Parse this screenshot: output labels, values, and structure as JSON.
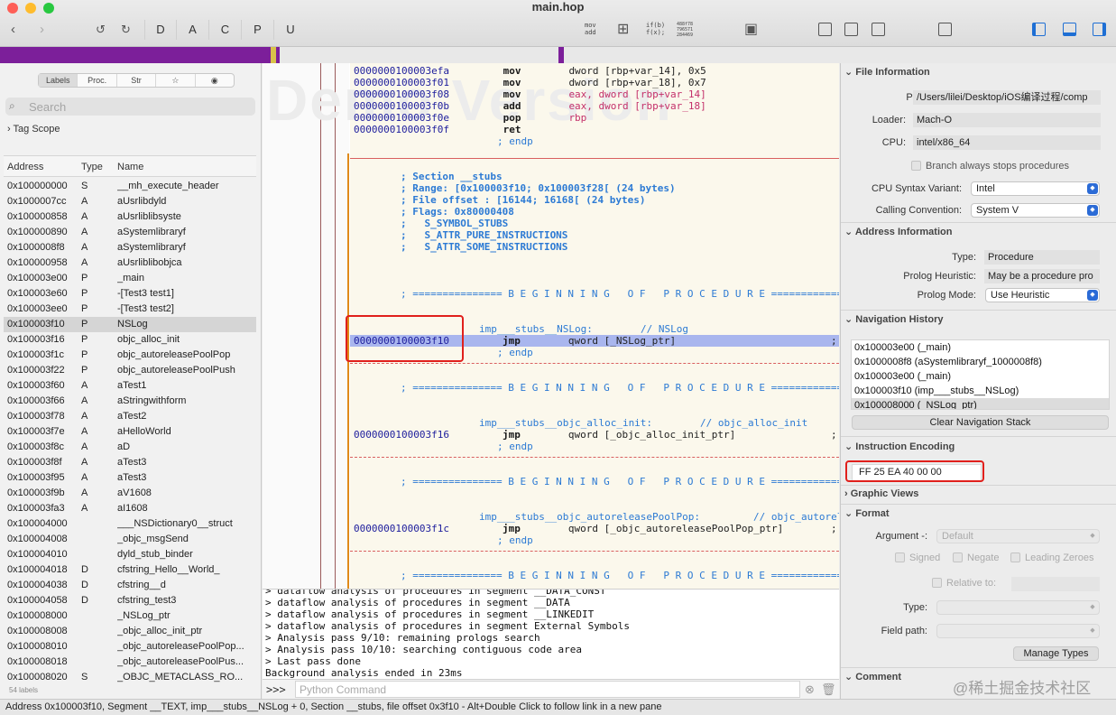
{
  "window": {
    "title": "main.hop"
  },
  "colors": {
    "accent": "#1f6fd4",
    "nav_band": "#7c1f9a",
    "highlight": "#a9b6ee",
    "callout": "#e0201c"
  },
  "toolbar": {
    "back_icon": "chevron-left-icon",
    "forward_icon": "chevron-right-icon",
    "undo_icon": "undo-icon",
    "redo_icon": "redo-icon",
    "mode_letters": [
      "D",
      "A",
      "C",
      "P",
      "U"
    ],
    "mov_add_line1": "mov",
    "mov_add_line2": "add",
    "ifb_line1": "if(b)",
    "ifb_line2": "f(x);",
    "hex_line1": "488f78",
    "hex_line2": "796571",
    "hex_line3": "284469"
  },
  "sidebar": {
    "tabs": [
      "Labels",
      "Proc.",
      "Str",
      "☆",
      "◉"
    ],
    "search_placeholder": "Search",
    "tag_scope": "Tag Scope",
    "columns": {
      "address": "Address",
      "type": "Type",
      "name": "Name"
    },
    "rows": [
      [
        "0x100000000",
        "S",
        "__mh_execute_header"
      ],
      [
        "0x1000007cc",
        "A",
        "aUsrlibdyld"
      ],
      [
        "0x100000858",
        "A",
        "aUsrliblibsyste"
      ],
      [
        "0x100000890",
        "A",
        "aSystemlibraryf"
      ],
      [
        "0x1000008f8",
        "A",
        "aSystemlibraryf"
      ],
      [
        "0x100000958",
        "A",
        "aUsrliblibobjca"
      ],
      [
        "0x100003e00",
        "P",
        "_main"
      ],
      [
        "0x100003e60",
        "P",
        "-[Test3 test1]"
      ],
      [
        "0x100003ee0",
        "P",
        "-[Test3 test2]"
      ],
      [
        "0x100003f10",
        "P",
        "NSLog"
      ],
      [
        "0x100003f16",
        "P",
        "objc_alloc_init"
      ],
      [
        "0x100003f1c",
        "P",
        "objc_autoreleasePoolPop"
      ],
      [
        "0x100003f22",
        "P",
        "objc_autoreleasePoolPush"
      ],
      [
        "0x100003f60",
        "A",
        "aTest1"
      ],
      [
        "0x100003f66",
        "A",
        "aStringwithform"
      ],
      [
        "0x100003f78",
        "A",
        "aTest2"
      ],
      [
        "0x100003f7e",
        "A",
        "aHelloWorld"
      ],
      [
        "0x100003f8c",
        "A",
        "aD"
      ],
      [
        "0x100003f8f",
        "A",
        "aTest3"
      ],
      [
        "0x100003f95",
        "A",
        "aTest3"
      ],
      [
        "0x100003f9b",
        "A",
        "aV1608"
      ],
      [
        "0x100003fa3",
        "A",
        "aI1608"
      ],
      [
        "0x100004000",
        "",
        "___NSDictionary0__struct"
      ],
      [
        "0x100004008",
        "",
        "_objc_msgSend"
      ],
      [
        "0x100004010",
        "",
        "dyld_stub_binder"
      ],
      [
        "0x100004018",
        "D",
        "cfstring_Hello__World_"
      ],
      [
        "0x100004038",
        "D",
        "cfstring__d"
      ],
      [
        "0x100004058",
        "D",
        "cfstring_test3"
      ],
      [
        "0x100008000",
        "",
        "_NSLog_ptr"
      ],
      [
        "0x100008008",
        "",
        "_objc_alloc_init_ptr"
      ],
      [
        "0x100008010",
        "",
        "_objc_autoreleasePoolPop..."
      ],
      [
        "0x100008018",
        "",
        "_objc_autoreleasePoolPus..."
      ],
      [
        "0x100008020",
        "S",
        "_OBJC_METACLASS_RO..."
      ]
    ],
    "selected_row": 9,
    "label_count": "54 labels"
  },
  "code": {
    "watermark": "Demo Version",
    "prologue": [
      [
        "0000000100003efa",
        "mov",
        "dword [rbp+var_14], 0x5"
      ],
      [
        "0000000100003f01",
        "mov",
        "dword [rbp+var_18], 0x7"
      ],
      [
        "0000000100003f08",
        "mov",
        "eax, dword [rbp+var_14]"
      ],
      [
        "0000000100003f0b",
        "add",
        "eax, dword [rbp+var_18]"
      ],
      [
        "0000000100003f0e",
        "pop",
        "rbp"
      ],
      [
        "0000000100003f0f",
        "ret",
        ""
      ]
    ],
    "endp": "; endp",
    "section_header": [
      "; Section __stubs",
      "; Range: [0x100003f10; 0x100003f28[ (24 bytes)",
      "; File offset : [16144; 16168[ (24 bytes)",
      "; Flags: 0x80000408",
      ";   S_SYMBOL_STUBS",
      ";   S_ATTR_PURE_INSTRUCTIONS",
      ";   S_ATTR_SOME_INSTRUCTIONS"
    ],
    "begin_proc": "; =============== B E G I N N I N G   O F   P R O C E D U R E ================",
    "procs": [
      {
        "label": "imp___stubs__NSLog:",
        "comment": "// NSLog",
        "addr": "0000000100003f10",
        "mnem": "jmp",
        "operand": "qword [_NSLog_ptr]",
        "tail": ";"
      },
      {
        "label": "imp___stubs__objc_alloc_init:",
        "comment": "// objc_alloc_init",
        "addr": "0000000100003f16",
        "mnem": "jmp",
        "operand": "qword [_objc_alloc_init_ptr]",
        "tail": ";"
      },
      {
        "label": "imp___stubs__objc_autoreleasePoolPop:",
        "comment": "// objc_autorele",
        "addr": "0000000100003f1c",
        "mnem": "jmp",
        "operand": "qword [_objc_autoreleasePoolPop_ptr]",
        "tail": ";"
      }
    ]
  },
  "console": {
    "lines": [
      "> dataflow analysis of procedures in segment __DATA_CONST",
      "> dataflow analysis of procedures in segment __DATA",
      "> dataflow analysis of procedures in segment __LINKEDIT",
      "> dataflow analysis of procedures in segment External Symbols",
      "> Analysis pass 9/10: remaining prologs search",
      "> Analysis pass 10/10: searching contiguous code area",
      "> Last pass done",
      "Background analysis ended in 23ms"
    ],
    "prompt": ">>>",
    "input_placeholder": "Python Command"
  },
  "status_bar": "Address 0x100003f10, Segment __TEXT, imp___stubs__NSLog + 0, Section __stubs, file offset 0x3f10 - Alt+Double Click to follow link in a new pane",
  "inspector": {
    "file_info": {
      "title": "File Information",
      "path_label": "Path:",
      "path": "/Users/lilei/Desktop/iOS编译过程/comp",
      "loader_label": "Loader:",
      "loader": "Mach-O",
      "cpu_label": "CPU:",
      "cpu": "intel/x86_64",
      "branch_label": "Branch always stops procedures",
      "syntax_label": "CPU Syntax Variant:",
      "syntax": "Intel",
      "calling_label": "Calling Convention:",
      "calling": "System V"
    },
    "address_info": {
      "title": "Address Information",
      "type_label": "Type:",
      "type": "Procedure",
      "heuristic_label": "Prolog Heuristic:",
      "heuristic": "May be a procedure pro",
      "mode_label": "Prolog Mode:",
      "mode": "Use Heuristic"
    },
    "nav_history": {
      "title": "Navigation History",
      "items": [
        "0x100003e00 (_main)",
        "0x1000008f8 (aSystemlibraryf_1000008f8)",
        "0x100003e00 (_main)",
        "0x100003f10 (imp___stubs__NSLog)",
        "0x100008000 (_NSLog_ptr)"
      ],
      "clear_button": "Clear Navigation Stack"
    },
    "encoding": {
      "title": "Instruction Encoding",
      "bytes": "FF 25 EA 40 00 00"
    },
    "graphic_views": {
      "title": "Graphic Views"
    },
    "format": {
      "title": "Format",
      "argument_label": "Argument -:",
      "argument": "Default",
      "signed": "Signed",
      "negate": "Negate",
      "leading": "Leading Zeroes",
      "relative_label": "Relative to:",
      "type_label": "Type:",
      "field_label": "Field path:",
      "manage_button": "Manage Types"
    },
    "comment": {
      "title": "Comment"
    },
    "watermark": "@稀土掘金技术社区"
  }
}
